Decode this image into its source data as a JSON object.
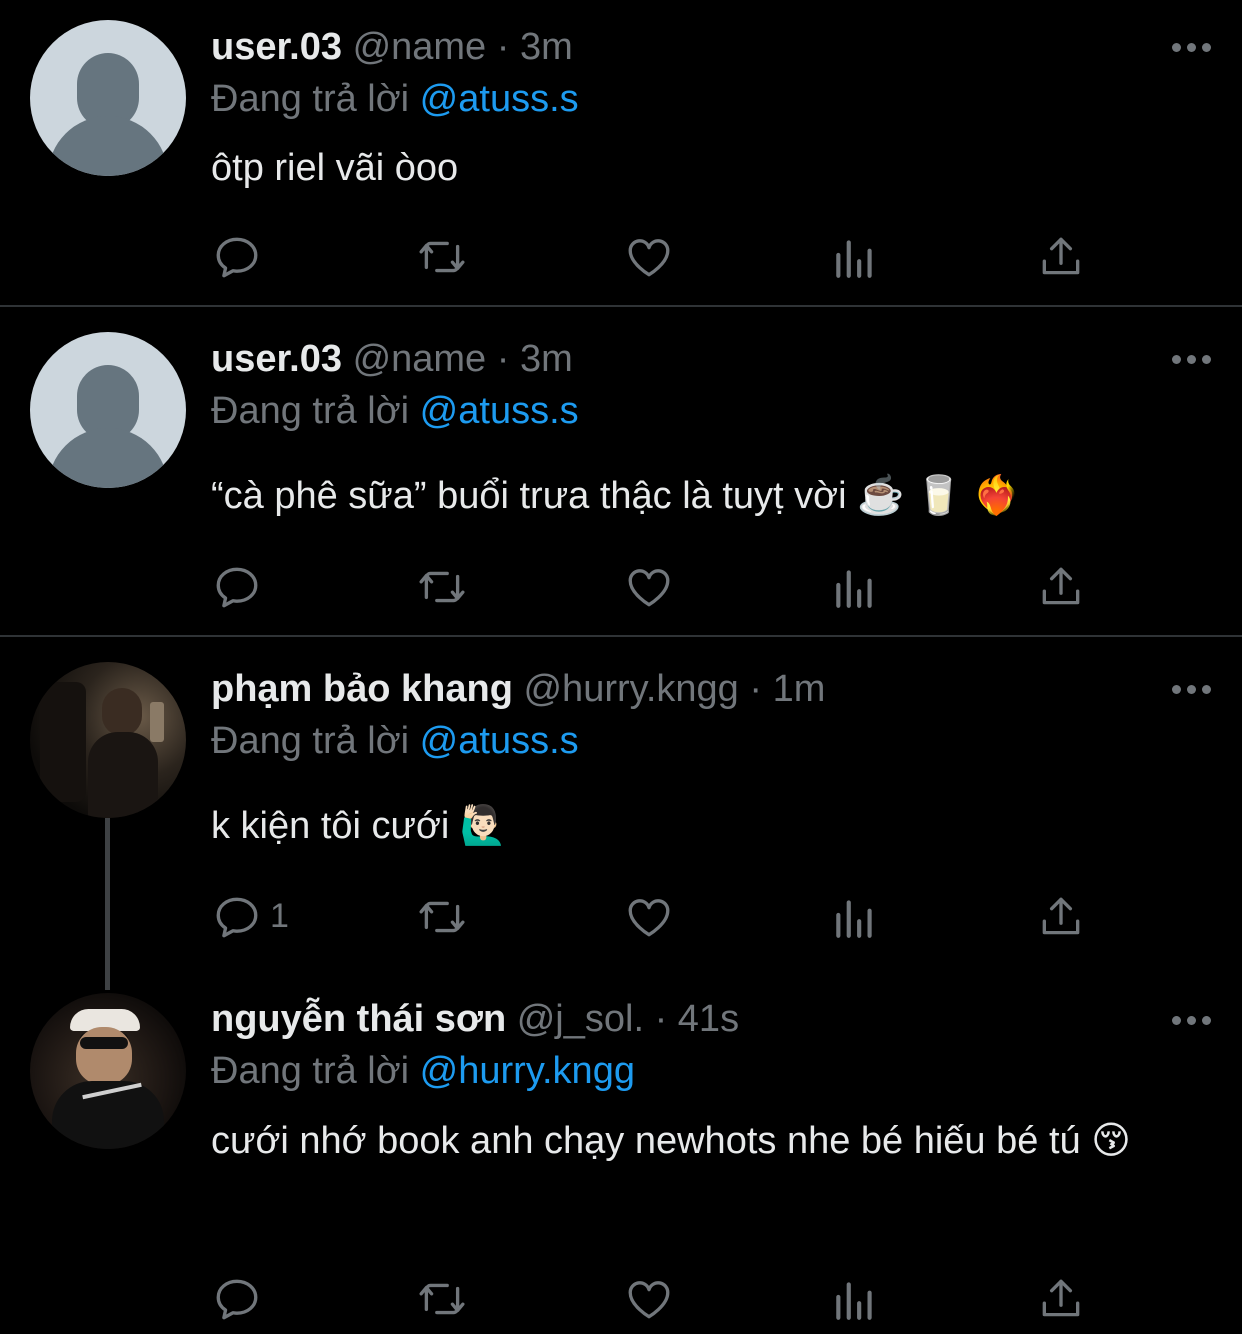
{
  "tweets": [
    {
      "display_name": "user.03",
      "handle": "@name",
      "separator": "·",
      "time": "3m",
      "reply_prefix": "Đang trả lời",
      "reply_to": "@atuss.s",
      "text": "ôtp riel vãi òoo",
      "reply_count": ""
    },
    {
      "display_name": "user.03",
      "handle": "@name",
      "separator": "·",
      "time": "3m",
      "reply_prefix": "Đang trả lời",
      "reply_to": "@atuss.s",
      "text": "“cà phê sữa” buổi trưa thậc là tuyṭ vời ☕️ 🥛 ❤️‍🔥",
      "reply_count": ""
    },
    {
      "display_name": "phạm bảo khang",
      "handle": "@hurry.kngg",
      "separator": "·",
      "time": "1m",
      "reply_prefix": "Đang trả lời",
      "reply_to": "@atuss.s",
      "text": "k kiện tôi cưới 🙋🏻‍♂️",
      "reply_count": "1"
    },
    {
      "display_name": "nguyễn thái sơn",
      "handle": "@j_sol.",
      "separator": "·",
      "time": "41s",
      "reply_prefix": "Đang trả lời",
      "reply_to": "@hurry.kngg",
      "text": "cưới nhớ book anh chạy newhots nhe bé hiếu bé tú 😚",
      "reply_count": ""
    }
  ],
  "icons": {
    "reply": "reply-icon",
    "retweet": "retweet-icon",
    "like": "heart-icon",
    "views": "views-icon",
    "share": "share-icon",
    "more": "more-icon"
  },
  "colors": {
    "background": "#000000",
    "text": "#e7e9ea",
    "muted": "#71767b",
    "link": "#1d9bf0",
    "separator": "#2f3336"
  }
}
